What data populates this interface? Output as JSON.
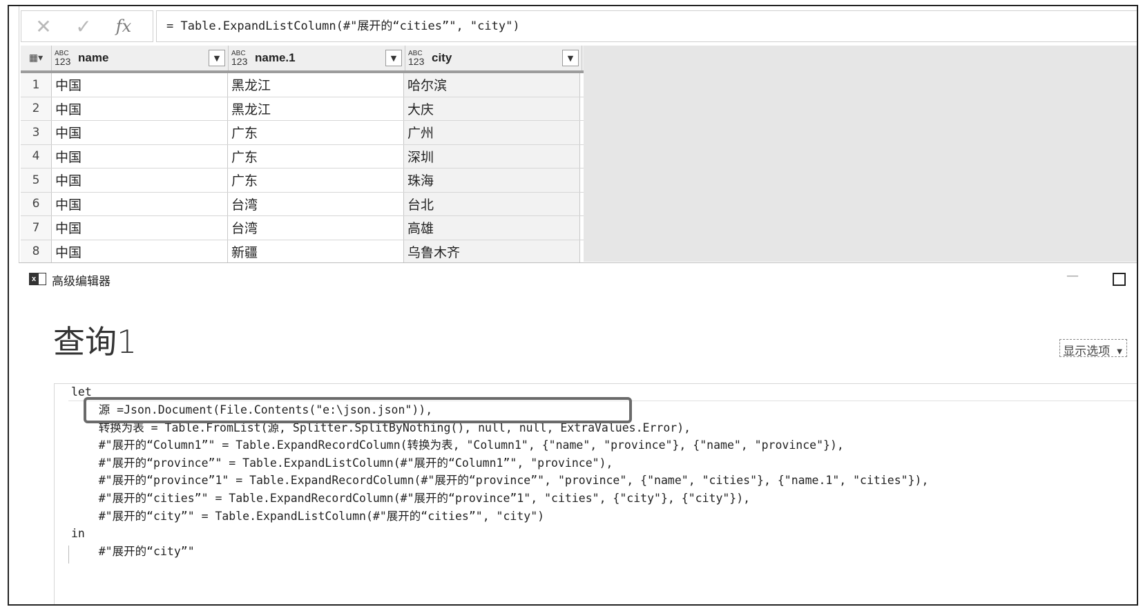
{
  "formula_bar": {
    "cancel_glyph": "✕",
    "confirm_glyph": "✓",
    "fx_label": "fx",
    "formula": "= Table.ExpandListColumn(#\"展开的“cities”\", \"city\")"
  },
  "grid": {
    "corner_glyph": "▦▾",
    "type_badge_top": "ABC",
    "type_badge_bottom": "123",
    "columns": [
      {
        "label": "name"
      },
      {
        "label": "name.1"
      },
      {
        "label": "city"
      }
    ],
    "rows": [
      {
        "num": "1",
        "name": "中国",
        "name1": "黑龙江",
        "city": "哈尔滨"
      },
      {
        "num": "2",
        "name": "中国",
        "name1": "黑龙江",
        "city": "大庆"
      },
      {
        "num": "3",
        "name": "中国",
        "name1": "广东",
        "city": "广州"
      },
      {
        "num": "4",
        "name": "中国",
        "name1": "广东",
        "city": "深圳"
      },
      {
        "num": "5",
        "name": "中国",
        "name1": "广东",
        "city": "珠海"
      },
      {
        "num": "6",
        "name": "中国",
        "name1": "台湾",
        "city": "台北"
      },
      {
        "num": "7",
        "name": "中国",
        "name1": "台湾",
        "city": "高雄"
      },
      {
        "num": "8",
        "name": "中国",
        "name1": "新疆",
        "city": "乌鲁木齐"
      }
    ]
  },
  "advanced_editor": {
    "window_title": "高级编辑器",
    "app_icon_letter": "x",
    "minimize_glyph": "—",
    "query_name": "查询1",
    "display_options": "显示选项",
    "code_lines": [
      "let",
      "    源 =Json.Document(File.Contents(\"e:\\json.json\")),",
      "    转换为表 = Table.FromList(源, Splitter.SplitByNothing(), null, null, ExtraValues.Error),",
      "    #\"展开的“Column1”\" = Table.ExpandRecordColumn(转换为表, \"Column1\", {\"name\", \"province\"}, {\"name\", \"province\"}),",
      "    #\"展开的“province”\" = Table.ExpandListColumn(#\"展开的“Column1”\", \"province\"),",
      "    #\"展开的“province”1\" = Table.ExpandRecordColumn(#\"展开的“province”\", \"province\", {\"name\", \"cities\"}, {\"name.1\", \"cities\"}),",
      "    #\"展开的“cities”\" = Table.ExpandRecordColumn(#\"展开的“province”1\", \"cities\", {\"city\"}, {\"city\"}),",
      "    #\"展开的“city”\" = Table.ExpandListColumn(#\"展开的“cities”\", \"city\")",
      "in",
      "    #\"展开的“city”\""
    ]
  }
}
